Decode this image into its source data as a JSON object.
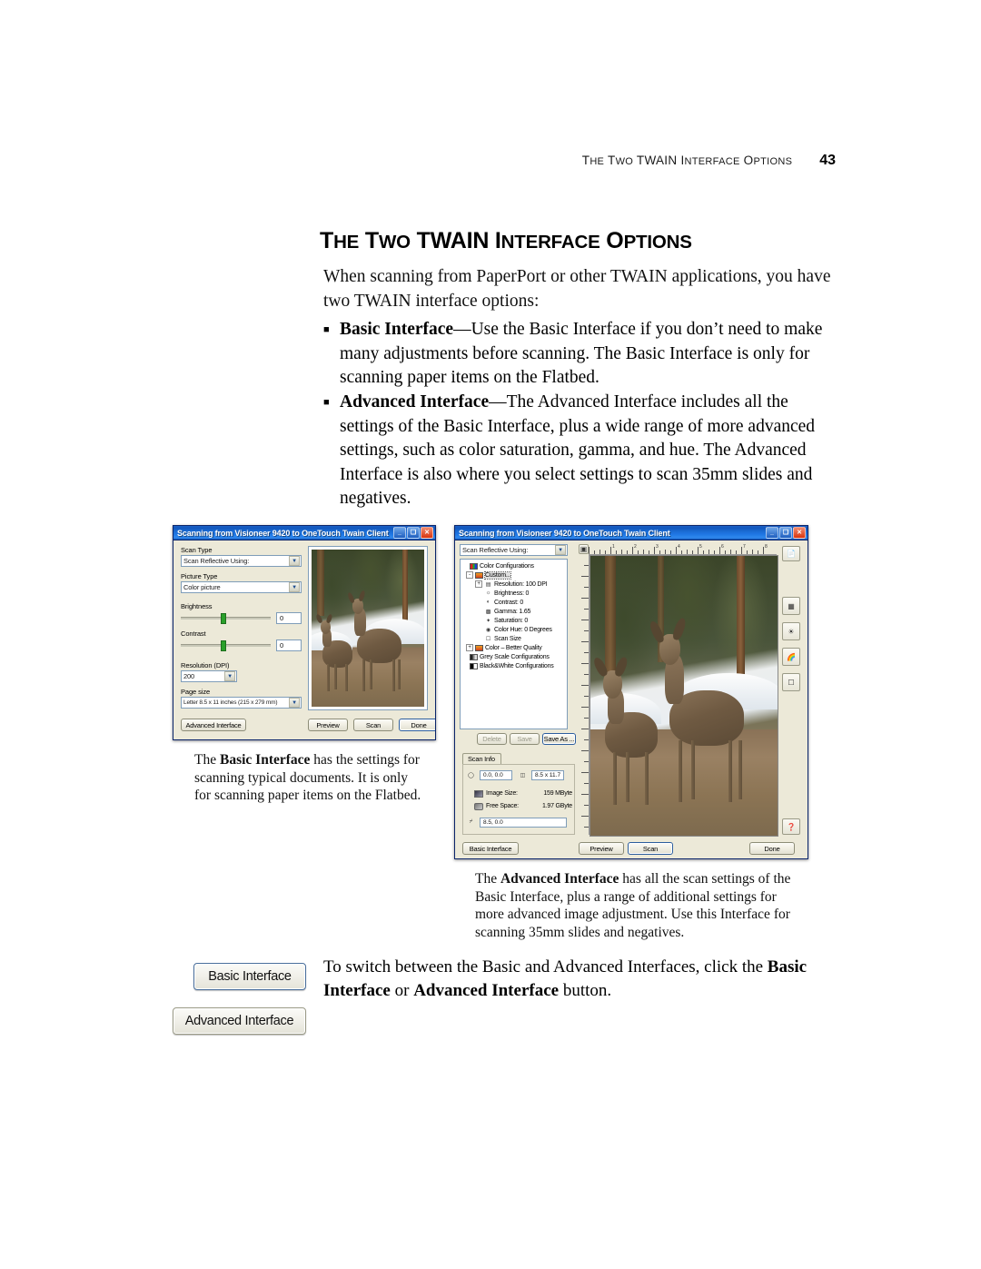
{
  "running_head": {
    "text_small_caps": "THE TWO TWAIN INTERFACE OPTIONS",
    "page_number": "43"
  },
  "heading": {
    "title": "THE TWO TWAIN INTERFACE OPTIONS"
  },
  "intro": {
    "paragraph": "When scanning from PaperPort or other TWAIN applications, you have two TWAIN interface options:"
  },
  "bullets": [
    {
      "marker": "■",
      "lead": "Basic Interface",
      "rest": "—Use the Basic Interface if you don’t need to make many adjustments before scanning. The Basic Interface is only for scanning paper items on the Flatbed."
    },
    {
      "marker": "■",
      "lead": "Advanced Interface",
      "rest": "—The Advanced Interface includes all the settings of the Basic Interface, plus a wide range of more advanced settings, such as color saturation, gamma, and hue. The Advanced Interface is also where you select settings to scan 35mm slides and negatives."
    }
  ],
  "captions": {
    "basic": {
      "lead_pre": "The ",
      "lead_bold": "Basic Interface",
      "rest": " has the settings for scanning typical documents. It is only for scanning paper items on the Flatbed."
    },
    "advanced": {
      "lead_pre": "The ",
      "lead_bold": "Advanced Interface",
      "rest": " has all the scan settings of the Basic Interface, plus a range of additional settings for more advanced image adjustment. Use this Interface for scanning 35mm slides and negatives."
    }
  },
  "closing": {
    "pre": "To switch between the Basic and Advanced Interfaces, click the ",
    "bold1": "Basic Interface",
    "mid": " or ",
    "bold2": "Advanced Interface",
    "post": " button."
  },
  "doc_buttons": {
    "basic_interface": "Basic Interface",
    "advanced_interface": "Advanced Interface"
  },
  "basic_dialog": {
    "title": "Scanning from Visioneer 9420 to OneTouch Twain Client",
    "caption_buttons": {
      "minimize": "_",
      "maximize": "❑",
      "close": "✕"
    },
    "labels": {
      "scan_type": "Scan Type",
      "picture_type": "Picture Type",
      "brightness": "Brightness",
      "contrast": "Contrast",
      "resolution": "Resolution (DPI)",
      "page_size": "Page size"
    },
    "values": {
      "scan_type": "Scan Reflective Using:",
      "picture_type": "Color picture",
      "brightness": "0",
      "contrast": "0",
      "resolution": "200",
      "page_size": "Letter 8.5 x 11 inches (215 x 279 mm)"
    },
    "buttons": {
      "advanced_interface": "Advanced Interface",
      "preview": "Preview",
      "scan": "Scan",
      "done": "Done"
    }
  },
  "advanced_dialog": {
    "title": "Scanning from Visioneer 9420 to OneTouch Twain Client",
    "caption_buttons": {
      "minimize": "_",
      "maximize": "❑",
      "close": "✕"
    },
    "source_combo": "Scan Reflective Using:",
    "tree": [
      {
        "label": "Color Configurations",
        "indent": 0,
        "icon": "color-swatch-icon",
        "expander": ""
      },
      {
        "label": "Custom...",
        "indent": 1,
        "icon": "custom-config-icon",
        "expander": "-",
        "selected": true
      },
      {
        "label": "Resolution: 100 DPI",
        "indent": 2,
        "icon": "resolution-icon",
        "expander": "+"
      },
      {
        "label": "Brightness: 0",
        "indent": 2,
        "icon": "brightness-icon",
        "expander": ""
      },
      {
        "label": "Contrast: 0",
        "indent": 2,
        "icon": "contrast-icon",
        "expander": ""
      },
      {
        "label": "Gamma: 1.65",
        "indent": 2,
        "icon": "gamma-icon",
        "expander": ""
      },
      {
        "label": "Saturation: 0",
        "indent": 2,
        "icon": "saturation-icon",
        "expander": ""
      },
      {
        "label": "Color Hue: 0 Degrees",
        "indent": 2,
        "icon": "color-hue-icon",
        "expander": ""
      },
      {
        "label": "Scan Size",
        "indent": 2,
        "icon": "scan-size-icon",
        "expander": ""
      },
      {
        "label": "Color – Better Quality",
        "indent": 1,
        "icon": "custom-config-icon",
        "expander": "+"
      },
      {
        "label": "Grey Scale Configurations",
        "indent": 0,
        "icon": "grey-swatch-icon",
        "expander": ""
      },
      {
        "label": "Black&White Configurations",
        "indent": 0,
        "icon": "bw-swatch-icon",
        "expander": ""
      }
    ],
    "config_buttons": {
      "delete": "Delete",
      "save": "Save",
      "save_as": "Save As ..."
    },
    "scan_info": {
      "tab_label": "Scan Info",
      "origin": "0.0, 0.0",
      "size": "8.5 x 11.7",
      "image_size_label": "Image Size:",
      "image_size_value": "159 MByte",
      "free_space_label": "Free Space:",
      "free_space_value": "1.97 GByte",
      "cursor_pos": "8.5, 0.0"
    },
    "ruler_ticks": [
      "1",
      "2",
      "3",
      "4",
      "5",
      "6",
      "7",
      "8"
    ],
    "side_tools": [
      "new-config-icon",
      "descreen-icon",
      "brightness-contrast-icon",
      "color-curve-icon",
      "page-crop-icon",
      "help-icon"
    ],
    "buttons": {
      "basic_interface": "Basic Interface",
      "preview": "Preview",
      "scan": "Scan",
      "done": "Done"
    }
  },
  "colors": {
    "titlebar_blue": "#1b63c8",
    "dialog_face": "#ece9d8",
    "field_border": "#7f9db9",
    "close_red": "#d8340f",
    "slider_green": "#2aa02a"
  }
}
